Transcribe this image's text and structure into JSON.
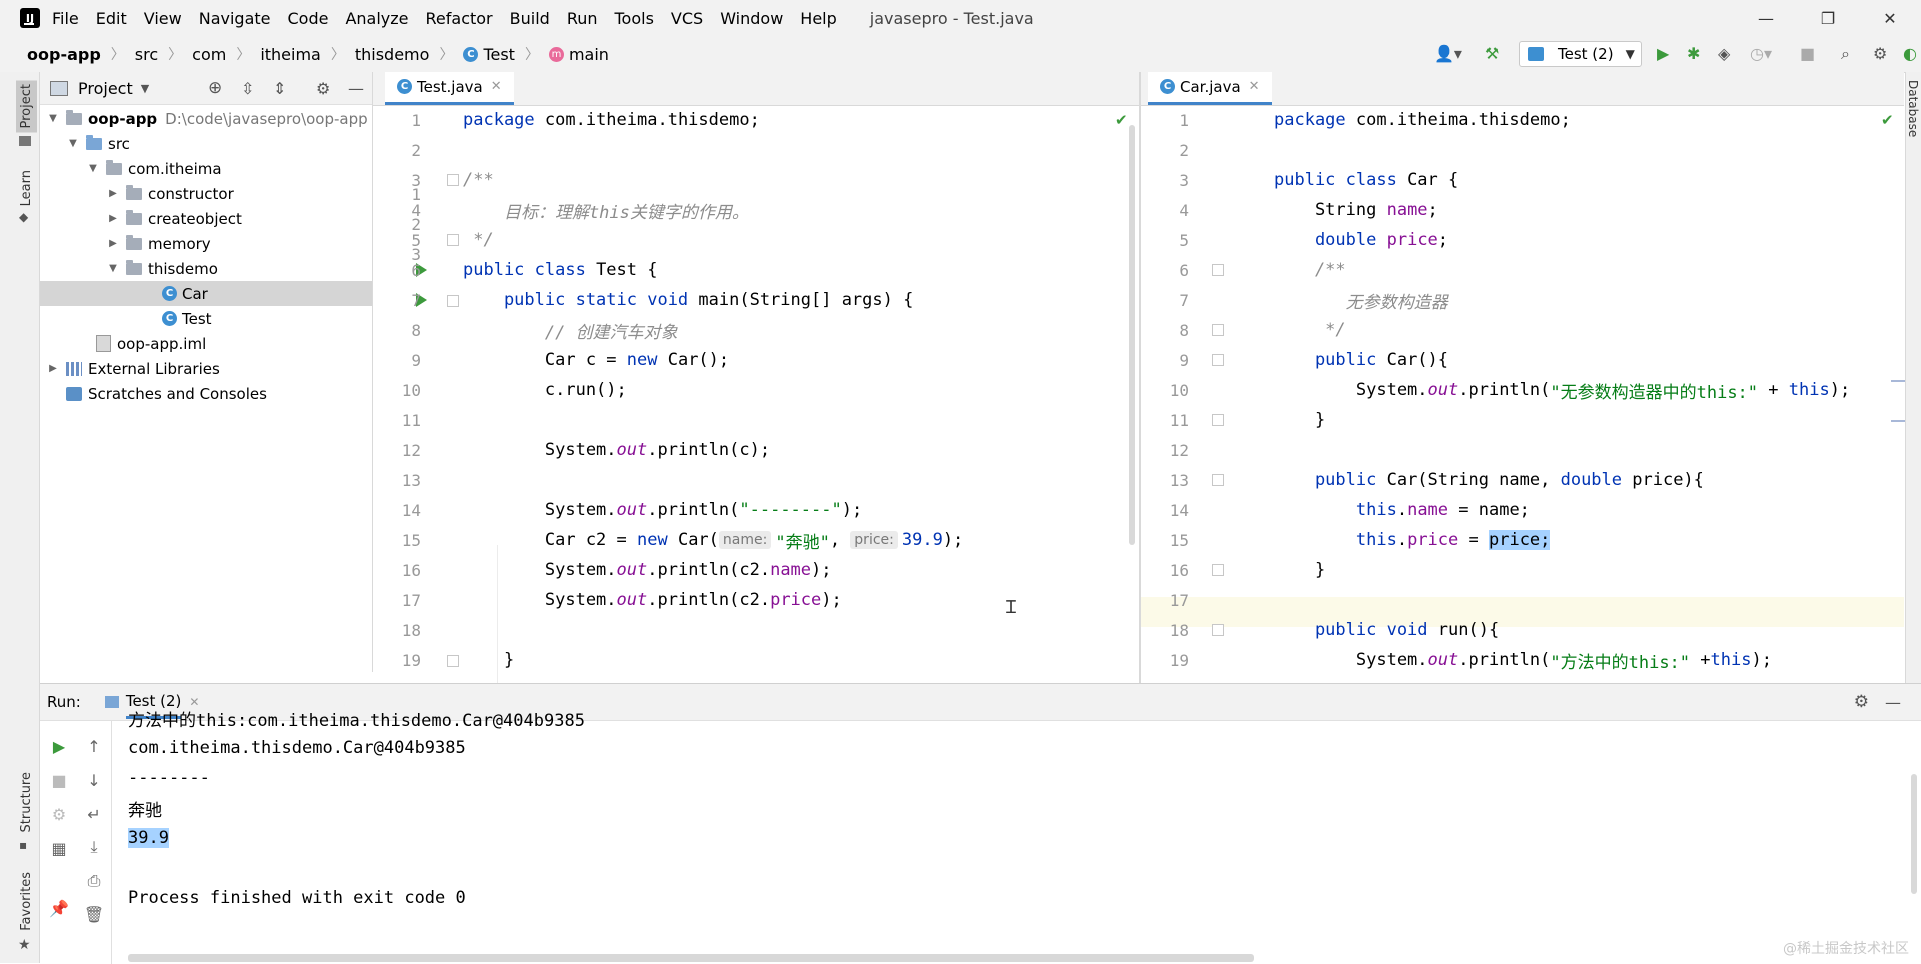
{
  "window": {
    "title": "javasepro - Test.java",
    "controls": [
      "—",
      "❐",
      "✕"
    ]
  },
  "menu": [
    "File",
    "Edit",
    "View",
    "Navigate",
    "Code",
    "Analyze",
    "Refactor",
    "Build",
    "Run",
    "Tools",
    "VCS",
    "Window",
    "Help"
  ],
  "breadcrumb": [
    "oop-app",
    "src",
    "com",
    "itheima",
    "thisdemo",
    "Test",
    "main"
  ],
  "run_config": "Test (2)",
  "left_strip": {
    "project": "Project",
    "learn": "Learn",
    "structure": "Structure",
    "favorites": "Favorites"
  },
  "right_strip": {
    "database": "Database"
  },
  "project_panel": {
    "title": "Project",
    "tree": [
      {
        "label": "oop-app",
        "extra": "D:\\code\\javasepro\\oop-app"
      },
      {
        "label": "src"
      },
      {
        "label": "com.itheima"
      },
      {
        "label": "constructor"
      },
      {
        "label": "createobject"
      },
      {
        "label": "memory"
      },
      {
        "label": "thisdemo"
      },
      {
        "label": "Car"
      },
      {
        "label": "Test"
      },
      {
        "label": "oop-app.iml"
      },
      {
        "label": "External Libraries"
      },
      {
        "label": "Scratches and Consoles"
      }
    ]
  },
  "editor_left": {
    "tab": "Test.java",
    "line_numbers": [
      "1",
      "2",
      "3",
      "4",
      "5",
      "6",
      "7",
      "8",
      "9",
      "10",
      "11",
      "12",
      "13",
      "14",
      "15",
      "16",
      "17",
      "18",
      "19"
    ],
    "code": {
      "l1_kw": "package",
      "l1_rest": " com.itheima.thisdemo;",
      "l3": "/**",
      "l4": "    目标：理解this关键字的作用。",
      "l5": " */",
      "l6_kw": "public class",
      "l6_rest": " Test {",
      "l7_kw": "    public static void",
      "l7_rest": " main(String[] args) {",
      "l8": "        // 创建汽车对象",
      "l9_a": "        Car c = ",
      "l9_kw": "new",
      "l9_b": " Car();",
      "l10": "        c.run();",
      "l12_a": "        System.",
      "l12_s": "out",
      "l12_b": ".println(c);",
      "l14_a": "        System.",
      "l14_s": "out",
      "l14_b": ".println(",
      "l14_str": "\"--------\"",
      "l14_c": ");",
      "l15_a": "        Car c2 = ",
      "l15_kw": "new",
      "l15_b": " Car(",
      "l15_h1": "name:",
      "l15_str": "\"奔驰\"",
      "l15_c": ", ",
      "l15_h2": "price:",
      "l15_num": "39.9",
      "l15_d": ");",
      "l16_a": "        System.",
      "l16_s": "out",
      "l16_b": ".println(c2.",
      "l16_f": "name",
      "l16_c": ");",
      "l17_a": "        System.",
      "l17_s": "out",
      "l17_b": ".println(c2.",
      "l17_f": "price",
      "l17_c": ");",
      "l19": "    }"
    }
  },
  "editor_right": {
    "tab": "Car.java",
    "line_numbers": [
      "1",
      "2",
      "3",
      "4",
      "5",
      "6",
      "7",
      "8",
      "9",
      "10",
      "11",
      "12",
      "13",
      "14",
      "15",
      "16",
      "17",
      "18",
      "19"
    ],
    "code": {
      "l1_kw": "package",
      "l1_rest": " com.itheima.thisdemo;",
      "l3_kw": "public class",
      "l3_rest": " Car {",
      "l4_a": "    String ",
      "l4_f": "name",
      "l4_b": ";",
      "l5_kw": "    double",
      "l5_a": " ",
      "l5_f": "price",
      "l5_b": ";",
      "l6": "    /**",
      "l7": "       无参数构造器",
      "l8": "     */",
      "l9_kw": "    public",
      "l9_rest": " Car(){",
      "l10_a": "        System.",
      "l10_s": "out",
      "l10_b": ".println(",
      "l10_str": "\"无参数构造器中的this:\"",
      "l10_c": " + ",
      "l10_kw": "this",
      "l10_d": ");",
      "l11": "    }",
      "l13_kw": "    public",
      "l13_a": " Car(String name, ",
      "l13_kw2": "double",
      "l13_b": " price){",
      "l14_kw": "        this",
      "l14_a": ".",
      "l14_f": "name",
      "l14_b": " = name;",
      "l15_kw": "        this",
      "l15_a": ".",
      "l15_f": "price",
      "l15_b": " = ",
      "l15_sel": "price;",
      "l16": "    }",
      "l18_kw": "    public void",
      "l18_rest": " run(){",
      "l19_a": "        System.",
      "l19_s": "out",
      "l19_b": ".println(",
      "l19_str": "\"方法中的this:\"",
      "l19_c": " +",
      "l19_kw": "this",
      "l19_d": ");"
    }
  },
  "run_panel": {
    "label": "Run:",
    "tab": "Test (2)",
    "output": [
      "方法中的this:com.itheima.thisdemo.Car@404b9385",
      "com.itheima.thisdemo.Car@404b9385",
      "--------",
      "奔驰",
      "39.9",
      "",
      "Process finished with exit code 0"
    ]
  },
  "watermark": "@稀土掘金技术社区"
}
